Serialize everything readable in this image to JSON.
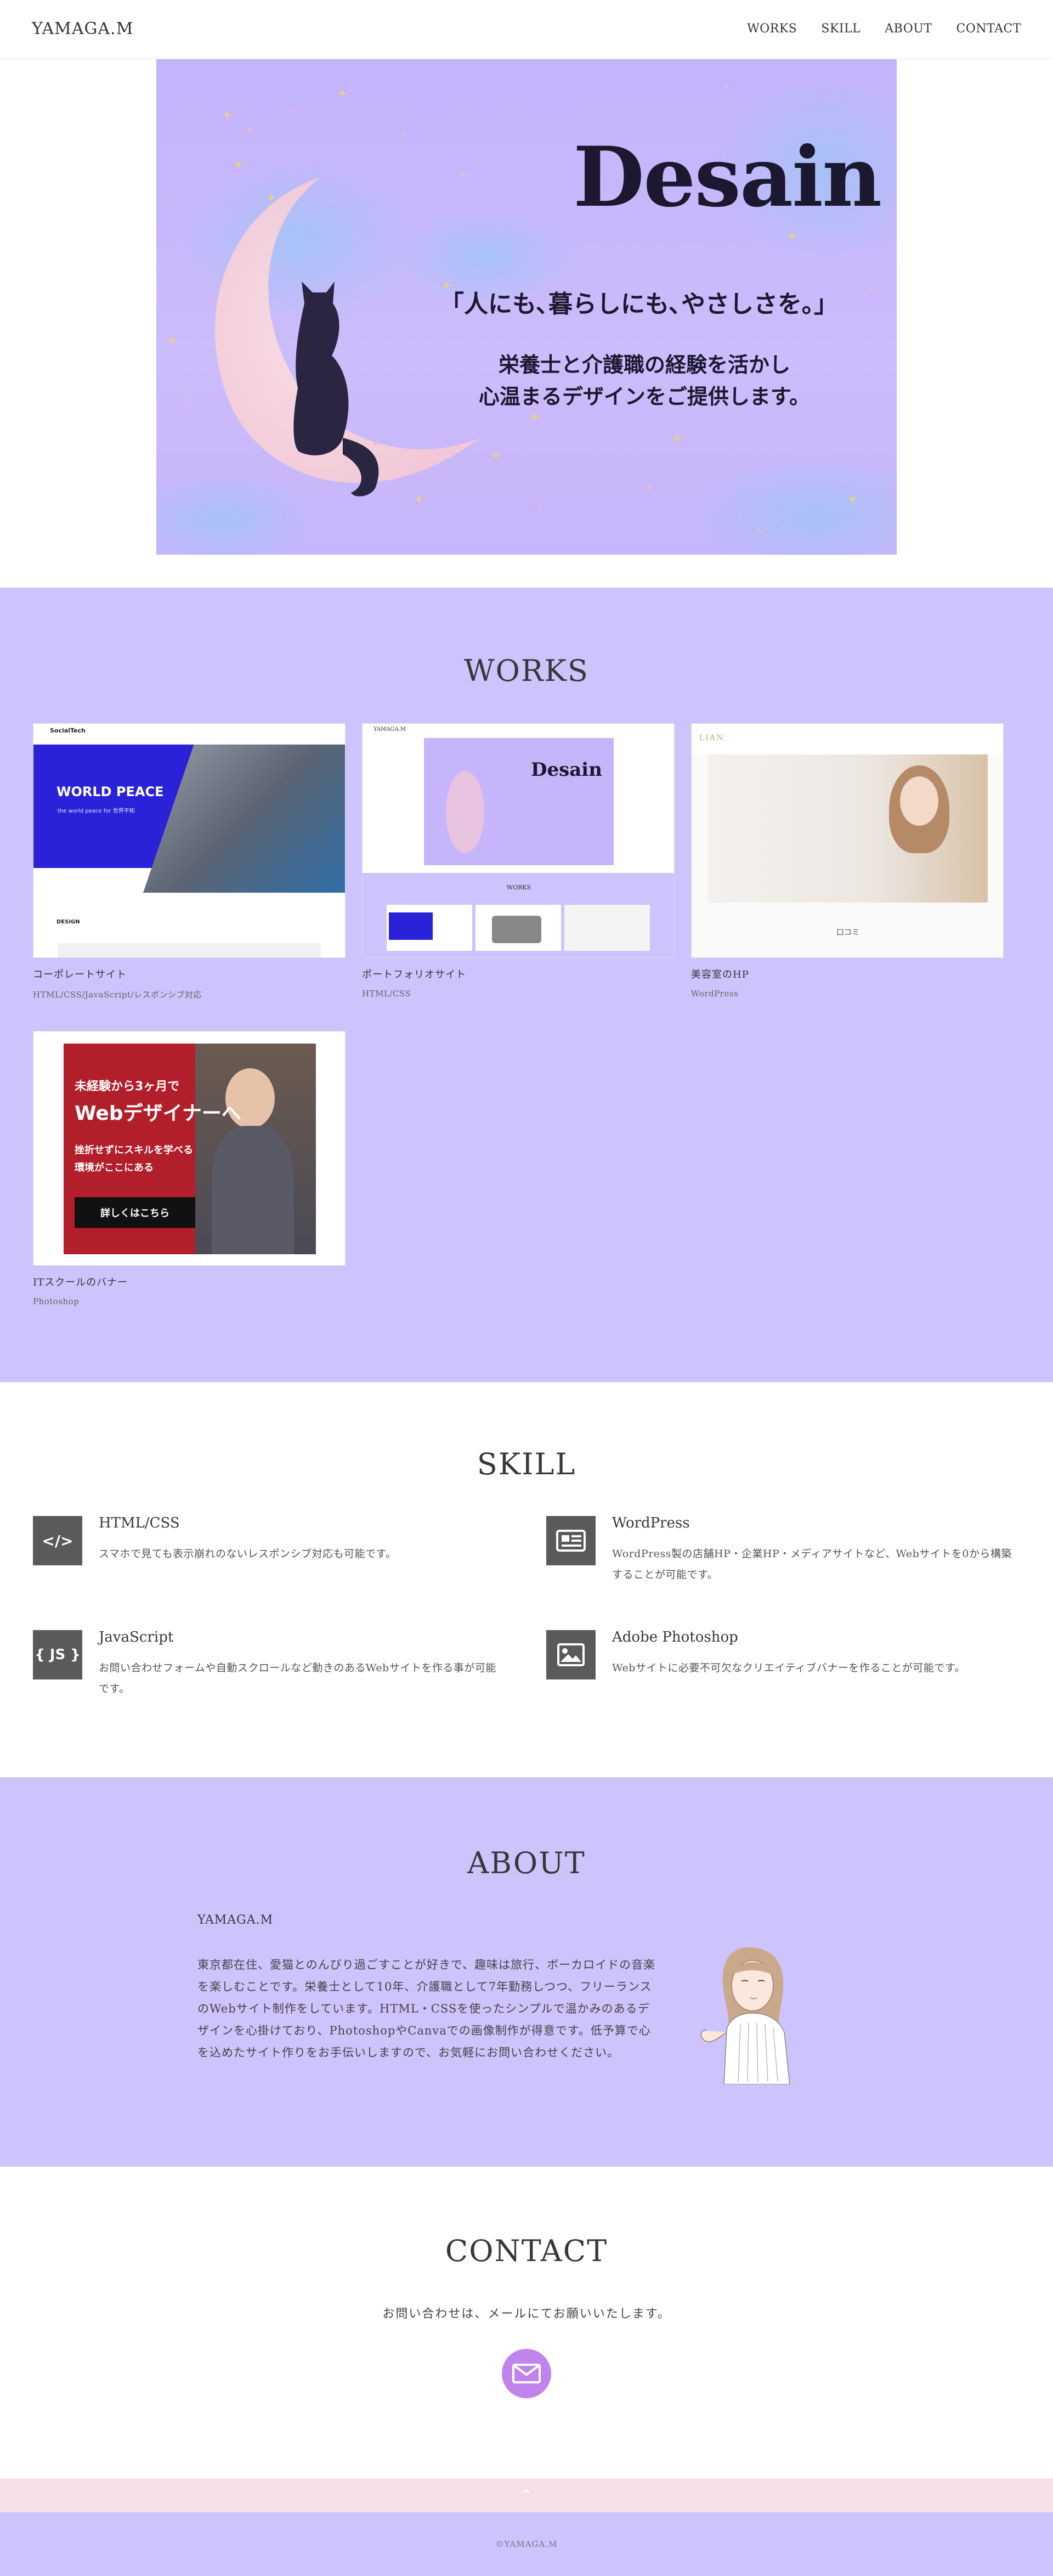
{
  "header": {
    "logo": "YAMAGA.M",
    "nav": [
      "WORKS",
      "SKILL",
      "ABOUT",
      "CONTACT"
    ]
  },
  "hero": {
    "title": "Desain",
    "tagline": "「人にも､暮らしにも､やさしさを｡」",
    "desc_line1": "栄養士と介護職の経験を活かし",
    "desc_line2": "心温まるデザインをご提供します。"
  },
  "works": {
    "title": "WORKS",
    "items": [
      {
        "name": "コーポレートサイト",
        "tech": "HTML/CSS/JavaScript/レスポンシブ対応",
        "thumb_heading": "WORLD PEACE",
        "thumb_sub": "the world peace for 世界平和",
        "thumb_logo": "SocialTech",
        "thumb_label": "DESIGN"
      },
      {
        "name": "ポートフォリオサイト",
        "tech": "HTML/CSS",
        "thumb_logo": "YAMAGA.M",
        "thumb_heading": "Desain",
        "thumb_works": "WORKS"
      },
      {
        "name": "美容室のHP",
        "tech": "WordPress",
        "thumb_logo": "LIAN",
        "thumb_label": "口コミ"
      },
      {
        "name": "ITスクールのバナー",
        "tech": "Photoshop",
        "banner_line1": "未経験から3ヶ月で",
        "banner_line2": "Webデザイナーへ",
        "banner_line3": "挫折せずにスキルを学べる",
        "banner_line4": "環境がここにある",
        "banner_button": "詳しくはこちら"
      }
    ]
  },
  "skill": {
    "title": "SKILL",
    "items": [
      {
        "icon": "code-icon",
        "icon_text": "</>",
        "name": "HTML/CSS",
        "desc": "スマホで見ても表示崩れのないレスポンシブ対応も可能です。"
      },
      {
        "icon": "news-icon",
        "icon_text": "",
        "name": "WordPress",
        "desc": "WordPress製の店舗HP・企業HP・メディアサイトなど、Webサイトを0から構築することが可能です。"
      },
      {
        "icon": "js-icon",
        "icon_text": "{ JS }",
        "name": "JavaScript",
        "desc": "お問い合わせフォームや自動スクロールなど動きのあるWebサイトを作る事が可能です。"
      },
      {
        "icon": "image-icon",
        "icon_text": "",
        "name": "Adobe Photoshop",
        "desc": "Webサイトに必要不可欠なクリエイティブバナーを作ることが可能です。"
      }
    ]
  },
  "about": {
    "title": "ABOUT",
    "name": "YAMAGA.M",
    "text": "東京都在住、愛猫とのんびり過ごすことが好きで、趣味は旅行、ボーカロイドの音楽を楽しむことです。栄養士として10年、介護職として7年勤務しつつ、フリーランスのWebサイト制作をしています。HTML・CSSを使ったシンプルで温かみのあるデザインを心掛けており、PhotoshopやCanvaでの画像制作が得意です。低予算で心を込めたサイト作りをお手伝いしますので、お気軽にお問い合わせください。"
  },
  "contact": {
    "title": "CONTACT",
    "text": "お問い合わせは、メールにてお願いいたします。"
  },
  "pagetop": "⌃",
  "footer": "©YAMAGA.M",
  "colors": {
    "lavender": "#cdc3fd",
    "mail_button": "#c084ec",
    "pagetop": "#f6dfe5",
    "icon_bg": "#5a5a5a"
  }
}
